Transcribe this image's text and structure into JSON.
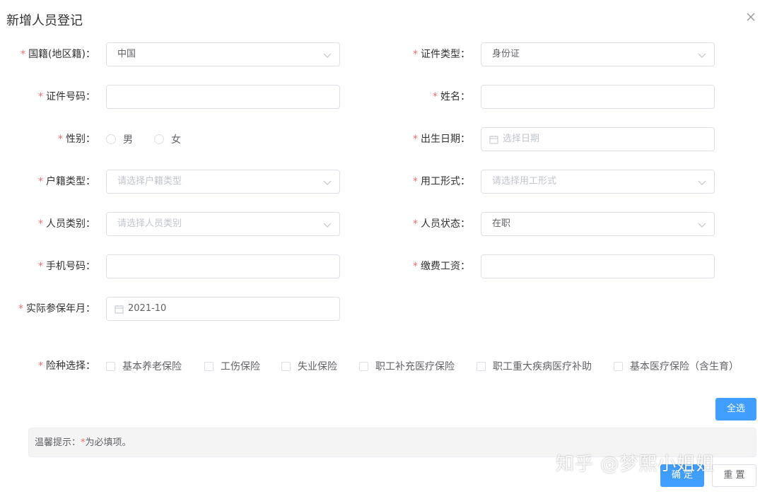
{
  "dialog": {
    "title": "新增人员登记"
  },
  "colors": {
    "primary": "#409eff",
    "required": "#f56c6c",
    "border": "#dcdfe6",
    "placeholder": "#c0c4cc",
    "tip_bg": "#f4f4f5"
  },
  "icons": {
    "close": "close-icon",
    "dropdown": "chevron-down-icon",
    "calendar": "calendar-icon"
  },
  "form": {
    "required_mark": "*",
    "nationality": {
      "label": "国籍(地区籍)：",
      "value": "中国"
    },
    "id_type": {
      "label": "证件类型：",
      "value": "身份证"
    },
    "id_number": {
      "label": "证件号码：",
      "value": ""
    },
    "name": {
      "label": "姓名：",
      "value": ""
    },
    "gender": {
      "label": "性别：",
      "options": [
        "男",
        "女"
      ]
    },
    "birth_date": {
      "label": "出生日期：",
      "placeholder": "选择日期"
    },
    "household_type": {
      "label": "户籍类型：",
      "placeholder": "请选择户籍类型"
    },
    "employment_form": {
      "label": "用工形式：",
      "placeholder": "请选择用工形式"
    },
    "person_category": {
      "label": "人员类别：",
      "placeholder": "请选择人员类别"
    },
    "person_status": {
      "label": "人员状态：",
      "value": "在职"
    },
    "phone": {
      "label": "手机号码：",
      "value": ""
    },
    "payment_wage": {
      "label": "缴费工资：",
      "value": ""
    },
    "insured_month": {
      "label": "实际参保年月：",
      "value": "2021-10"
    },
    "insurance": {
      "label": "险种选择：",
      "options": [
        "基本养老保险",
        "工伤保险",
        "失业保险",
        "职工补充医疗保险",
        "职工重大疾病医疗补助",
        "基本医疗保险（含生育）"
      ]
    }
  },
  "buttons": {
    "select_all": "全选",
    "confirm": "确 定",
    "reset": "重 置"
  },
  "tip": {
    "prefix": "温馨提示：",
    "star": "*",
    "suffix": "为必填项。"
  },
  "watermark": "知乎 @梦熙小姐姐"
}
